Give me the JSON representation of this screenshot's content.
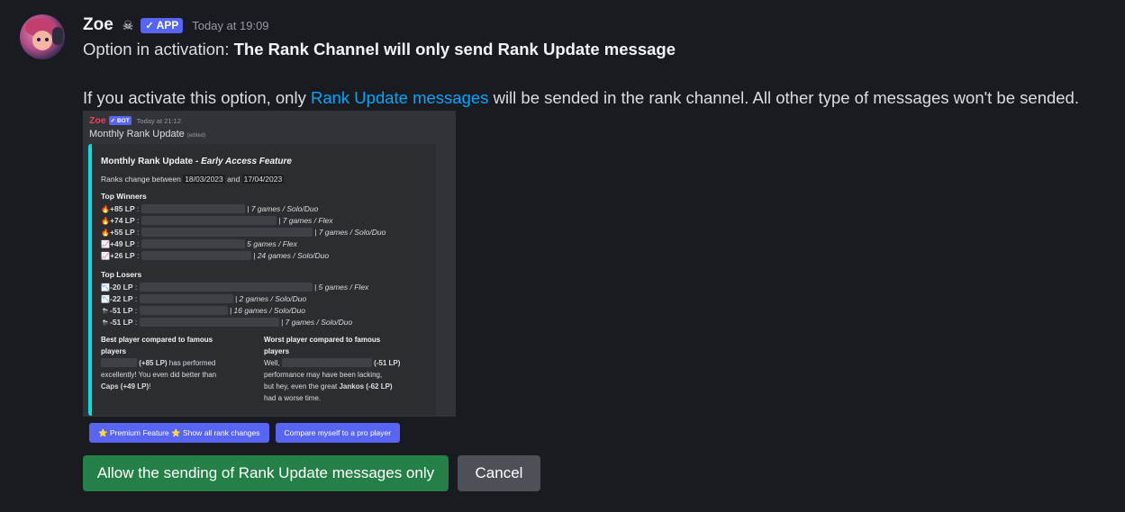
{
  "message": {
    "username": "Zoe",
    "badge_icon": "skull-icon",
    "app_badge": "APP",
    "timestamp": "Today at 19:09",
    "line1_prefix": "Option in activation: ",
    "line1_bold": "The Rank Channel will only send Rank Update message",
    "line2_prefix": "If you activate this option, only ",
    "line2_link": "Rank Update messages",
    "line2_suffix": " will be sended in the rank channel. All other type of messages won't be sended."
  },
  "embedded": {
    "username": "Zoe",
    "bot_badge": "BOT",
    "timestamp": "Today at 21:12",
    "title": "Monthly Rank Update",
    "edited": "(edited)",
    "embed": {
      "title_plain": "Monthly Rank Update - ",
      "title_italic": "Early Access Feature",
      "ranks_prefix": "Ranks change between ",
      "date_from": "18/03/2023",
      "ranks_and": " and ",
      "date_to": "17/04/2023",
      "winners_heading": "Top Winners",
      "winners": [
        {
          "icon": "fire-icon",
          "lp": "+85 LP",
          "info": "| 7 games / Solo/Duo"
        },
        {
          "icon": "fire-icon",
          "lp": "+74 LP",
          "info": "| 7 games / Flex"
        },
        {
          "icon": "fire-icon",
          "lp": "+55 LP",
          "info": "| 7 games / Solo/Duo"
        },
        {
          "icon": "chart-up-icon",
          "lp": "+49 LP",
          "info": "5 games / Flex"
        },
        {
          "icon": "chart-up-icon",
          "lp": "+26 LP",
          "info": "| 24 games / Solo/Duo"
        }
      ],
      "losers_heading": "Top Losers",
      "losers": [
        {
          "icon": "chart-down-icon",
          "lp": "-20 LP",
          "info": "| 5 games / Flex"
        },
        {
          "icon": "chart-down-icon",
          "lp": "-22 LP",
          "info": "| 2 games / Solo/Duo"
        },
        {
          "icon": "storm-icon",
          "lp": "-51 LP",
          "info": "| 16 games / Solo/Duo"
        },
        {
          "icon": "storm-icon",
          "lp": "-51 LP",
          "info": "| 7 games / Solo/Duo"
        }
      ],
      "best_heading_1": "Best player compared to famous",
      "best_heading_2": "players",
      "best_l1_bold": "(+85 LP)",
      "best_l1_rest": " has performed",
      "best_l2": "excellently! You even did better than",
      "best_l3_bold": "Caps (+49 LP)",
      "best_l3_rest": "!",
      "worst_heading_1": "Worst player compared to famous",
      "worst_heading_2": "players",
      "worst_l1_prefix": "Well, ",
      "worst_l1_bold": "(-51 LP)",
      "worst_l2": "performance may have been lacking,",
      "worst_l3_prefix": "but hey, even the great ",
      "worst_l3_bold": "Jankos (-62 LP)",
      "worst_l4": "had a worse time."
    },
    "buttons": {
      "premium": "Premium Feature",
      "show_all": "Show all rank changes",
      "compare": "Compare myself to a pro player"
    }
  },
  "actions": {
    "allow": "Allow the sending of Rank Update messages only",
    "cancel": "Cancel"
  },
  "colors": {
    "accent": "#5865f2",
    "embed_border": "#00e1e1",
    "link": "#00a8fc",
    "success": "#248046",
    "secondary": "#4e5058"
  }
}
